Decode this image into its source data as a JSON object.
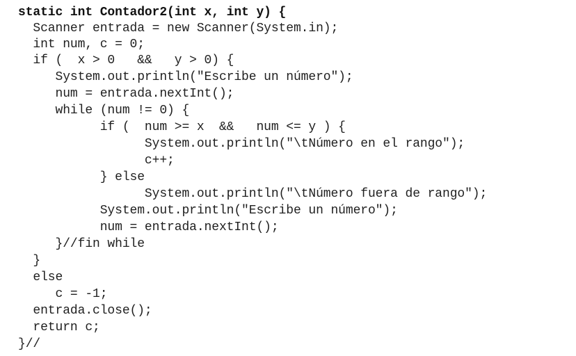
{
  "document": {
    "language": "Java",
    "lines": [
      {
        "text": "static int Contador2(int x, int y) {",
        "bold": true
      },
      {
        "text": "  Scanner entrada = new Scanner(System.in);"
      },
      {
        "text": "  int num, c = 0;"
      },
      {
        "text": "  if (  x > 0   &&   y > 0) {"
      },
      {
        "text": "     System.out.println(\"Escribe un número\");"
      },
      {
        "text": "     num = entrada.nextInt();"
      },
      {
        "text": "     while (num != 0) {"
      },
      {
        "text": "           if (  num >= x  &&   num <= y ) {"
      },
      {
        "text": "                 System.out.println(\"\\tNúmero en el rango\");"
      },
      {
        "text": "                 c++;"
      },
      {
        "text": "           } else"
      },
      {
        "text": "                 System.out.println(\"\\tNúmero fuera de rango\");"
      },
      {
        "text": "           System.out.println(\"Escribe un número\");"
      },
      {
        "text": "           num = entrada.nextInt();"
      },
      {
        "text": "     }//fin while"
      },
      {
        "text": "  }"
      },
      {
        "text": "  else"
      },
      {
        "text": "     c = -1;"
      },
      {
        "text": "  entrada.close();"
      },
      {
        "text": "  return c;"
      },
      {
        "text": "}//"
      }
    ]
  }
}
